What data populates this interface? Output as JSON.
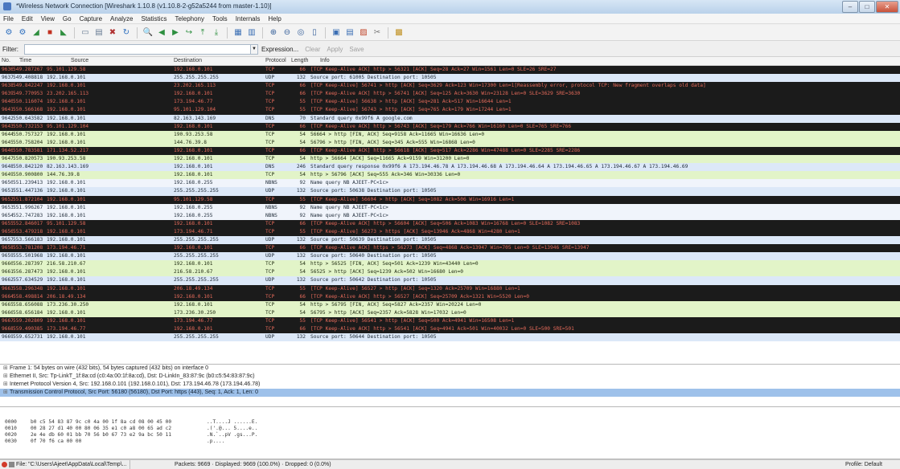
{
  "window": {
    "title": "*Wireless Network Connection  [Wireshark 1.10.8  (v1.10.8-2-g52a5244 from master-1.10)]",
    "controls": [
      "–",
      "□",
      "✕"
    ]
  },
  "menu": [
    "File",
    "Edit",
    "View",
    "Go",
    "Capture",
    "Analyze",
    "Statistics",
    "Telephony",
    "Tools",
    "Internals",
    "Help"
  ],
  "toolbar_icons": [
    "interfaces-icon",
    "options-icon",
    "start-capture-icon",
    "stop-capture-icon",
    "restart-capture-icon",
    "sep",
    "open-file-icon",
    "save-file-icon",
    "close-file-icon",
    "reload-icon",
    "sep",
    "find-icon",
    "back-icon",
    "forward-icon",
    "goto-icon",
    "first-packet-icon",
    "last-packet-icon",
    "sep",
    "colorize-icon",
    "autoscroll-icon",
    "sep",
    "zoom-in-icon",
    "zoom-out-icon",
    "zoom-normal-icon",
    "resize-columns-icon",
    "sep",
    "capture-filters-icon",
    "display-filters-icon",
    "coloring-rules-icon",
    "preferences-icon",
    "sep",
    "help-icon"
  ],
  "filter": {
    "label": "Filter:",
    "value": "",
    "actions": [
      "Expression...",
      "Clear",
      "Apply",
      "Save"
    ]
  },
  "columns": [
    "No.",
    "Time",
    "Source",
    "Destination",
    "Protocol",
    "Length",
    "Info"
  ],
  "packets": [
    {
      "no": "9636",
      "time": "549.287267",
      "src": "95.101.129.58",
      "dst": "192.168.0.101",
      "proto": "TCP",
      "len": "66",
      "info": "[TCP Keep-Alive ACK] http > 56321 [ACK] Seq=28 Ack=27 Win=1561 Len=0 SLE=26 SRE=27",
      "cls": "bad"
    },
    {
      "no": "9637",
      "time": "549.408818",
      "src": "192.168.0.101",
      "dst": "255.255.255.255",
      "proto": "UDP",
      "len": "132",
      "info": "Source port: 61005  Destination port: 10505",
      "cls": "udp"
    },
    {
      "no": "9638",
      "time": "549.842247",
      "src": "192.168.0.101",
      "dst": "23.202.165.113",
      "proto": "TCP",
      "len": "66",
      "info": "[TCP Keep-Alive] 56741 > http [ACK] Seq=3629 Ack=123 Win=17300 Len=1[Reassembly error, protocol TCP: New fragment overlaps old data]",
      "cls": "bad"
    },
    {
      "no": "9639",
      "time": "549.770953",
      "src": "23.202.165.113",
      "dst": "192.168.0.101",
      "proto": "TCP",
      "len": "66",
      "info": "[TCP Keep-Alive ACK] http > 56741 [ACK] Seq=125 Ack=3630 Win=23128 Len=0 SLE=3629 SRE=3630",
      "cls": "bad"
    },
    {
      "no": "9640",
      "time": "550.116074",
      "src": "192.168.0.101",
      "dst": "173.194.46.77",
      "proto": "TCP",
      "len": "55",
      "info": "[TCP Keep-Alive] 56638 > http [ACK] Seq=281 Ack=517 Win=16644 Len=1",
      "cls": "bad"
    },
    {
      "no": "9641",
      "time": "550.566168",
      "src": "192.168.0.101",
      "dst": "95.101.129.104",
      "proto": "TCP",
      "len": "55",
      "info": "[TCP Keep-Alive] 56743 > http [ACK] Seq=765 Ack=179 Win=17244 Len=1",
      "cls": "bad"
    },
    {
      "no": "9642",
      "time": "550.643582",
      "src": "192.168.0.101",
      "dst": "82.163.143.169",
      "proto": "DNS",
      "len": "70",
      "info": "Standard query 0x99f6  A google.com",
      "cls": "dns"
    },
    {
      "no": "9643",
      "time": "550.732153",
      "src": "95.101.129.104",
      "dst": "192.168.0.101",
      "proto": "TCP",
      "len": "66",
      "info": "[TCP Keep-Alive ACK] http > 56743 [ACK] Seq=179 Ack=766 Win=16160 Len=0 SLE=765 SRE=766",
      "cls": "bad"
    },
    {
      "no": "9644",
      "time": "550.757327",
      "src": "192.168.0.101",
      "dst": "190.93.253.58",
      "proto": "TCP",
      "len": "54",
      "info": "56664 > http [FIN, ACK] Seq=9158 Ack=11665 Win=16636 Len=0",
      "cls": "http"
    },
    {
      "no": "9645",
      "time": "550.758204",
      "src": "192.168.0.101",
      "dst": "144.76.39.8",
      "proto": "TCP",
      "len": "54",
      "info": "56796 > http [FIN, ACK] Seq=345 Ack=555 Win=16868 Len=0",
      "cls": "http"
    },
    {
      "no": "9646",
      "time": "550.783581",
      "src": "171.134.52.217",
      "dst": "192.168.0.101",
      "proto": "TCP",
      "len": "66",
      "info": "[TCP Keep-Alive ACK] http > 56618 [ACK] Seq=517 Ack=2286 Win=47488 Len=0 SLE=2285 SRE=2286",
      "cls": "bad"
    },
    {
      "no": "9647",
      "time": "550.820573",
      "src": "190.93.253.58",
      "dst": "192.168.0.101",
      "proto": "TCP",
      "len": "54",
      "info": "http > 56664 [ACK] Seq=11665 Ack=9159 Win=31200 Len=0",
      "cls": "http"
    },
    {
      "no": "9648",
      "time": "550.842120",
      "src": "82.163.143.169",
      "dst": "192.168.0.101",
      "proto": "DNS",
      "len": "246",
      "info": "Standard query response 0x99f6  A 173.194.46.78 A 173.194.46.68 A 173.194.46.64 A 173.194.46.65 A 173.194.46.67 A 173.194.46.69",
      "cls": "dns"
    },
    {
      "no": "9649",
      "time": "550.900800",
      "src": "144.76.39.8",
      "dst": "192.168.0.101",
      "proto": "TCP",
      "len": "54",
      "info": "http > 56796 [ACK] Seq=555 Ack=346 Win=30336 Len=0",
      "cls": "http"
    },
    {
      "no": "9650",
      "time": "551.239413",
      "src": "192.168.0.101",
      "dst": "192.168.0.255",
      "proto": "NBNS",
      "len": "92",
      "info": "Name query NB AJEET-PC<1c>",
      "cls": "nbns"
    },
    {
      "no": "9651",
      "time": "551.447136",
      "src": "192.168.0.101",
      "dst": "255.255.255.255",
      "proto": "UDP",
      "len": "132",
      "info": "Source port: 50638  Destination port: 10505",
      "cls": "udp"
    },
    {
      "no": "9652",
      "time": "551.872104",
      "src": "192.168.0.101",
      "dst": "95.101.129.58",
      "proto": "TCP",
      "len": "55",
      "info": "[TCP Keep-Alive] 56604 > http [ACK] Seq=1082 Ack=506 Win=16916 Len=1",
      "cls": "bad"
    },
    {
      "no": "9653",
      "time": "551.996267",
      "src": "192.168.0.101",
      "dst": "192.168.0.255",
      "proto": "NBNS",
      "len": "92",
      "info": "Name query NB AJEET-PC<1c>",
      "cls": "nbns"
    },
    {
      "no": "9654",
      "time": "552.747283",
      "src": "192.168.0.101",
      "dst": "192.168.0.255",
      "proto": "NBNS",
      "len": "92",
      "info": "Name query NB AJEET-PC<1c>",
      "cls": "nbns"
    },
    {
      "no": "9655",
      "time": "552.846017",
      "src": "95.101.129.58",
      "dst": "192.168.0.101",
      "proto": "TCP",
      "len": "66",
      "info": "[TCP Keep-Alive ACK] http > 56604 [ACK] Seq=506 Ack=1083 Win=16768 Len=0 SLE=1082 SRE=1083",
      "cls": "bad"
    },
    {
      "no": "9656",
      "time": "553.479218",
      "src": "192.168.0.101",
      "dst": "173.194.46.71",
      "proto": "TCP",
      "len": "55",
      "info": "[TCP Keep-Alive] 56273 > https [ACK] Seq=13946 Ack=4868 Win=4280 Len=1",
      "cls": "bad"
    },
    {
      "no": "9657",
      "time": "553.566183",
      "src": "192.168.0.101",
      "dst": "255.255.255.255",
      "proto": "UDP",
      "len": "132",
      "info": "Source port: 50639  Destination port: 10505",
      "cls": "udp"
    },
    {
      "no": "9658",
      "time": "553.781208",
      "src": "173.194.46.71",
      "dst": "192.168.0.101",
      "proto": "TCP",
      "len": "66",
      "info": "[TCP Keep-Alive ACK] https > 56273 [ACK] Seq=4868 Ack=13947 Win=705 Len=0 SLE=13946 SRE=13947",
      "cls": "bad"
    },
    {
      "no": "9659",
      "time": "555.501968",
      "src": "192.168.0.101",
      "dst": "255.255.255.255",
      "proto": "UDP",
      "len": "132",
      "info": "Source port: 50640  Destination port: 10505",
      "cls": "udp"
    },
    {
      "no": "9660",
      "time": "556.287397",
      "src": "216.58.210.67",
      "dst": "192.168.0.101",
      "proto": "TCP",
      "len": "54",
      "info": "http > 56525 [FIN, ACK] Seq=501 Ack=1239 Win=43440 Len=0",
      "cls": "http"
    },
    {
      "no": "9661",
      "time": "556.287473",
      "src": "192.168.0.101",
      "dst": "216.58.210.67",
      "proto": "TCP",
      "len": "54",
      "info": "56525 > http [ACK] Seq=1239 Ack=502 Win=16680 Len=0",
      "cls": "http"
    },
    {
      "no": "9662",
      "time": "557.634529",
      "src": "192.168.0.101",
      "dst": "255.255.255.255",
      "proto": "UDP",
      "len": "132",
      "info": "Source port: 50642  Destination port: 10505",
      "cls": "udp"
    },
    {
      "no": "9663",
      "time": "558.296348",
      "src": "192.168.0.101",
      "dst": "206.18.49.134",
      "proto": "TCP",
      "len": "55",
      "info": "[TCP Keep-Alive] 56527 > http [ACK] Seq=1320 Ack=25709 Win=16880 Len=1",
      "cls": "bad"
    },
    {
      "no": "9664",
      "time": "558.498814",
      "src": "206.18.49.134",
      "dst": "192.168.0.101",
      "proto": "TCP",
      "len": "66",
      "info": "[TCP Keep-Alive ACK] http > 56527 [ACK] Seq=25709 Ack=1321 Win=5520 Len=0",
      "cls": "bad"
    },
    {
      "no": "9665",
      "time": "558.656088",
      "src": "173.236.30.250",
      "dst": "192.168.0.101",
      "proto": "TCP",
      "len": "54",
      "info": "http > 56795 [FIN, ACK] Seq=5827 Ack=2357 Win=20224 Len=0",
      "cls": "http"
    },
    {
      "no": "9666",
      "time": "558.656184",
      "src": "192.168.0.101",
      "dst": "173.236.30.250",
      "proto": "TCP",
      "len": "54",
      "info": "56795 > http [ACK] Seq=2357 Ack=5828 Win=17032 Len=0",
      "cls": "http"
    },
    {
      "no": "9667",
      "time": "559.202809",
      "src": "192.168.0.101",
      "dst": "173.194.46.77",
      "proto": "TCP",
      "len": "55",
      "info": "[TCP Keep-Alive] 56541 > http [ACK] Seq=500 Ack=4941 Win=16508 Len=1",
      "cls": "bad"
    },
    {
      "no": "9668",
      "time": "559.490385",
      "src": "173.194.46.77",
      "dst": "192.168.0.101",
      "proto": "TCP",
      "len": "66",
      "info": "[TCP Keep-Alive ACK] http > 56541 [ACK] Seq=4941 Ack=501 Win=40032 Len=0 SLE=500 SRE=501",
      "cls": "bad"
    },
    {
      "no": "9669",
      "time": "559.652731",
      "src": "192.168.0.101",
      "dst": "255.255.255.255",
      "proto": "UDP",
      "len": "132",
      "info": "Source port: 50644  Destination port: 10505",
      "cls": "udp"
    }
  ],
  "details": [
    {
      "text": "Frame 1: 54 bytes on wire (432 bits), 54 bytes captured (432 bits) on interface 0",
      "selected": false
    },
    {
      "text": "Ethernet II, Src: Tp-LinkT_1f:8a:cd (c0:4a:00:1f:8a:cd), Dst: D-LinkIn_83:87:9c (b0:c5:54:83:87:9c)",
      "selected": false
    },
    {
      "text": "Internet Protocol Version 4, Src: 192.168.0.101 (192.168.0.101), Dst: 173.194.46.78 (173.194.46.78)",
      "selected": false
    },
    {
      "text": "Transmission Control Protocol, Src Port: 56180 (56180), Dst Port: https (443), Seq: 1, Ack: 1, Len: 0",
      "selected": true
    }
  ],
  "bytes": [
    {
      "off": "0000",
      "hex": "b0 c5 54 83 87 9c c0 4a  00 1f 8a cd 08 00 45 00",
      "ascii": "..T....J ......E."
    },
    {
      "off": "0010",
      "hex": "00 28 27 d1 40 00 80 06  35 e1 c0 a8 00 65 ad c2",
      "ascii": ".('.@... 5....e.."
    },
    {
      "off": "0020",
      "hex": "2e 4e db 60 01 bb 70 56  b0 67 73 e2 9a bc 50 11",
      ".ascii": "",
      "ascii": ".N.`..pV .gs...P."
    },
    {
      "off": "0030",
      "hex": "0f 70 f6 ca 00 00",
      "ascii": ".p...."
    }
  ],
  "status": {
    "file": "File: \"C:\\Users\\Ajeet\\AppData\\Local\\Temp\\...",
    "packets": "Packets: 9669 · Displayed: 9669 (100.0%) · Dropped: 0 (0.0%)",
    "profile": "Profile: Default"
  },
  "colors": {
    "udp": "#dce8f8",
    "tcp": "#e8ddf5",
    "http": "#e2f4c8",
    "bad_bg": "#1b1b1b",
    "bad_fg": "#e46a5a",
    "selected": "#9ec1ea"
  }
}
